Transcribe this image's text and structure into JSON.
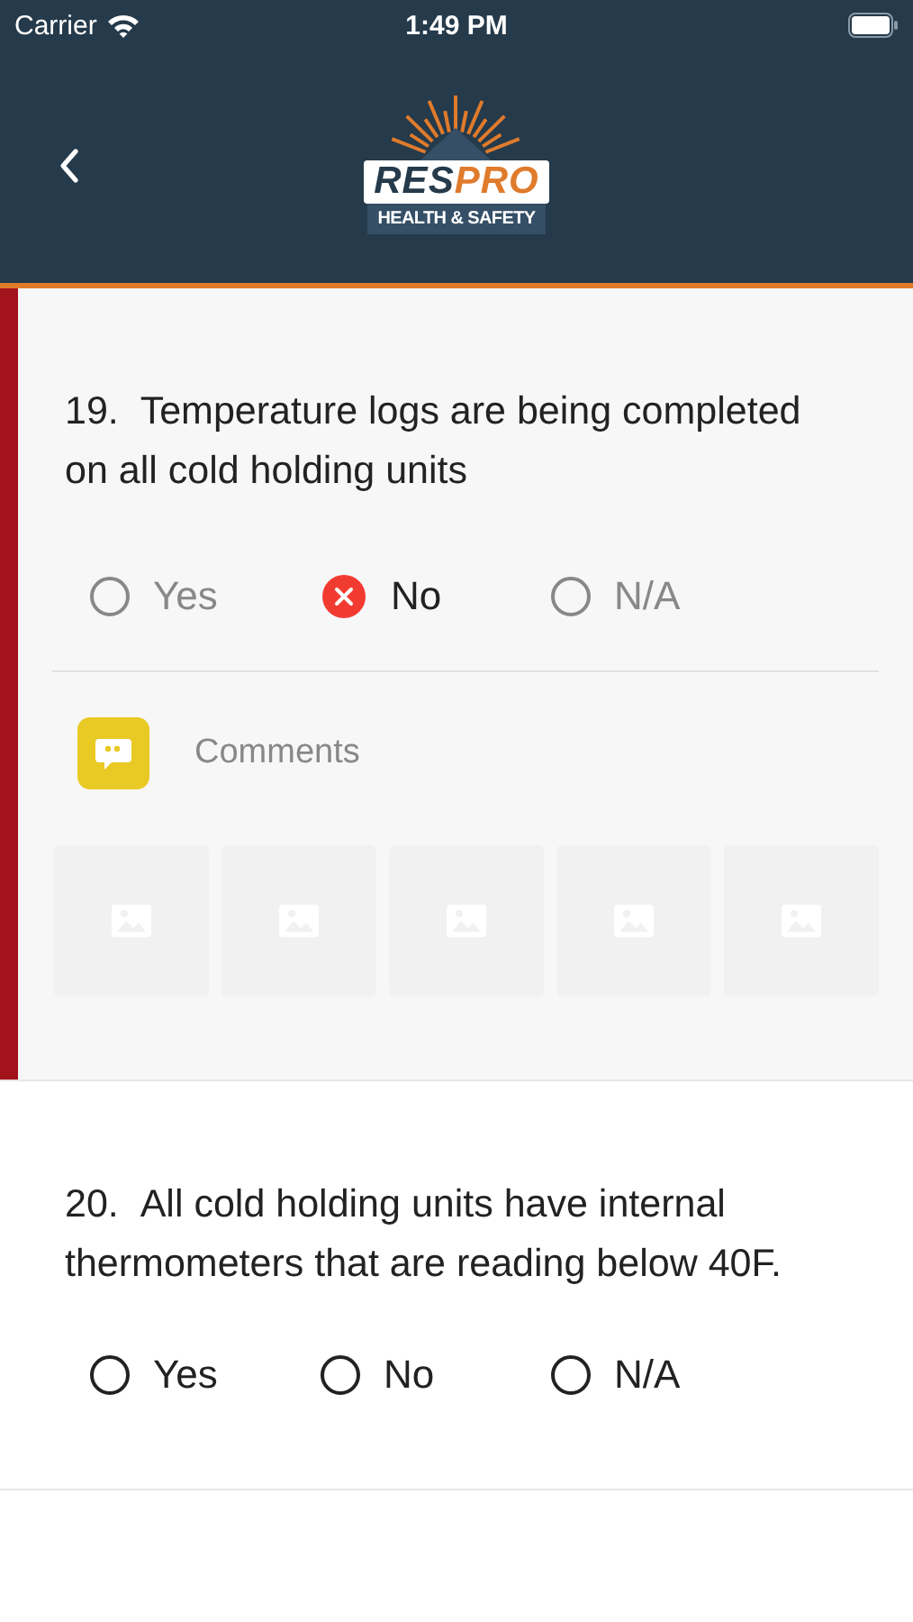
{
  "status_bar": {
    "carrier": "Carrier",
    "time": "1:49 PM"
  },
  "header": {
    "brand_parts": [
      "RES",
      "PRO"
    ],
    "tagline": "HEALTH & SAFETY"
  },
  "questions": [
    {
      "number": "19.",
      "text": "Temperature logs are being completed on all cold holding units",
      "flagged": true,
      "expanded": true,
      "options": [
        {
          "label": "Yes",
          "selected": false
        },
        {
          "label": "No",
          "selected": true
        },
        {
          "label": "N/A",
          "selected": false
        }
      ],
      "comments_placeholder": "Comments",
      "photo_slots": [
        {
          "filled": false
        },
        {
          "filled": false
        },
        {
          "filled": false
        },
        {
          "filled": false
        },
        {
          "filled": false
        }
      ]
    },
    {
      "number": "20.",
      "text": "All cold holding units have internal thermometers that are reading below 40F.",
      "flagged": false,
      "expanded": false,
      "options": [
        {
          "label": "Yes",
          "selected": false
        },
        {
          "label": "No",
          "selected": false
        },
        {
          "label": "N/A",
          "selected": false
        }
      ]
    }
  ]
}
